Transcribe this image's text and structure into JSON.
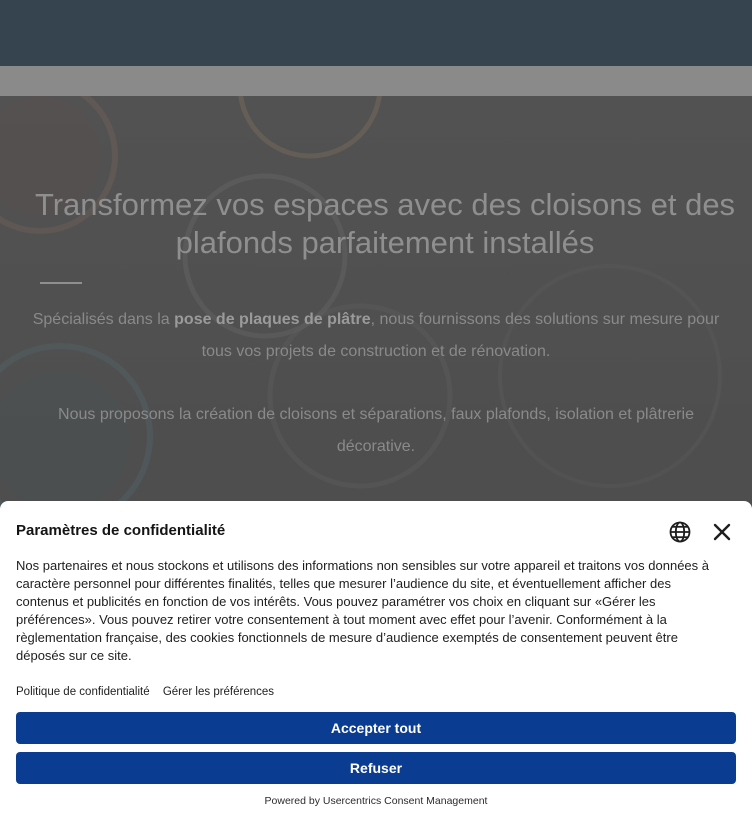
{
  "hero": {
    "title": "Transformez vos espaces avec des cloisons et des plafonds parfaitement installés",
    "paragraph1": {
      "before": "Spécialisés dans la ",
      "bold": "pose de plaques de plâtre",
      "after": ", nous fournissons des solutions sur mesure pour tous vos projets de construction et de rénovation."
    },
    "paragraph2": "Nous proposons la création de cloisons et séparations, faux plafonds, isolation et plâtrerie décorative."
  },
  "consent": {
    "title": "Paramètres de confidentialité",
    "body": "Nos partenaires et nous stockons et utilisons des informations non sensibles sur votre appareil et traitons vos données à caractère personnel pour différentes finalités, telles que mesurer l’audience du site, et éventuellement afficher des contenus et publicités en fonction de vos intérêts. Vous pouvez paramétrer vos choix en cliquant sur «Gérer les préférences». Vous pouvez retirer votre consentement à tout moment avec effet pour l’avenir. Conformément à la règlementation française, des cookies fonctionnels de mesure d’audience exemptés de consentement peuvent être déposés sur ce site.",
    "privacy_link": "Politique de confidentialité",
    "manage_link": "Gérer les préférences",
    "accept_label": "Accepter tout",
    "refuse_label": "Refuser",
    "powered_by": "Powered by Usercentrics Consent Management",
    "icons": {
      "language": "globe-icon",
      "close": "close-icon"
    }
  },
  "colors": {
    "topbar": "#36444f",
    "button": "#0a3d91"
  }
}
